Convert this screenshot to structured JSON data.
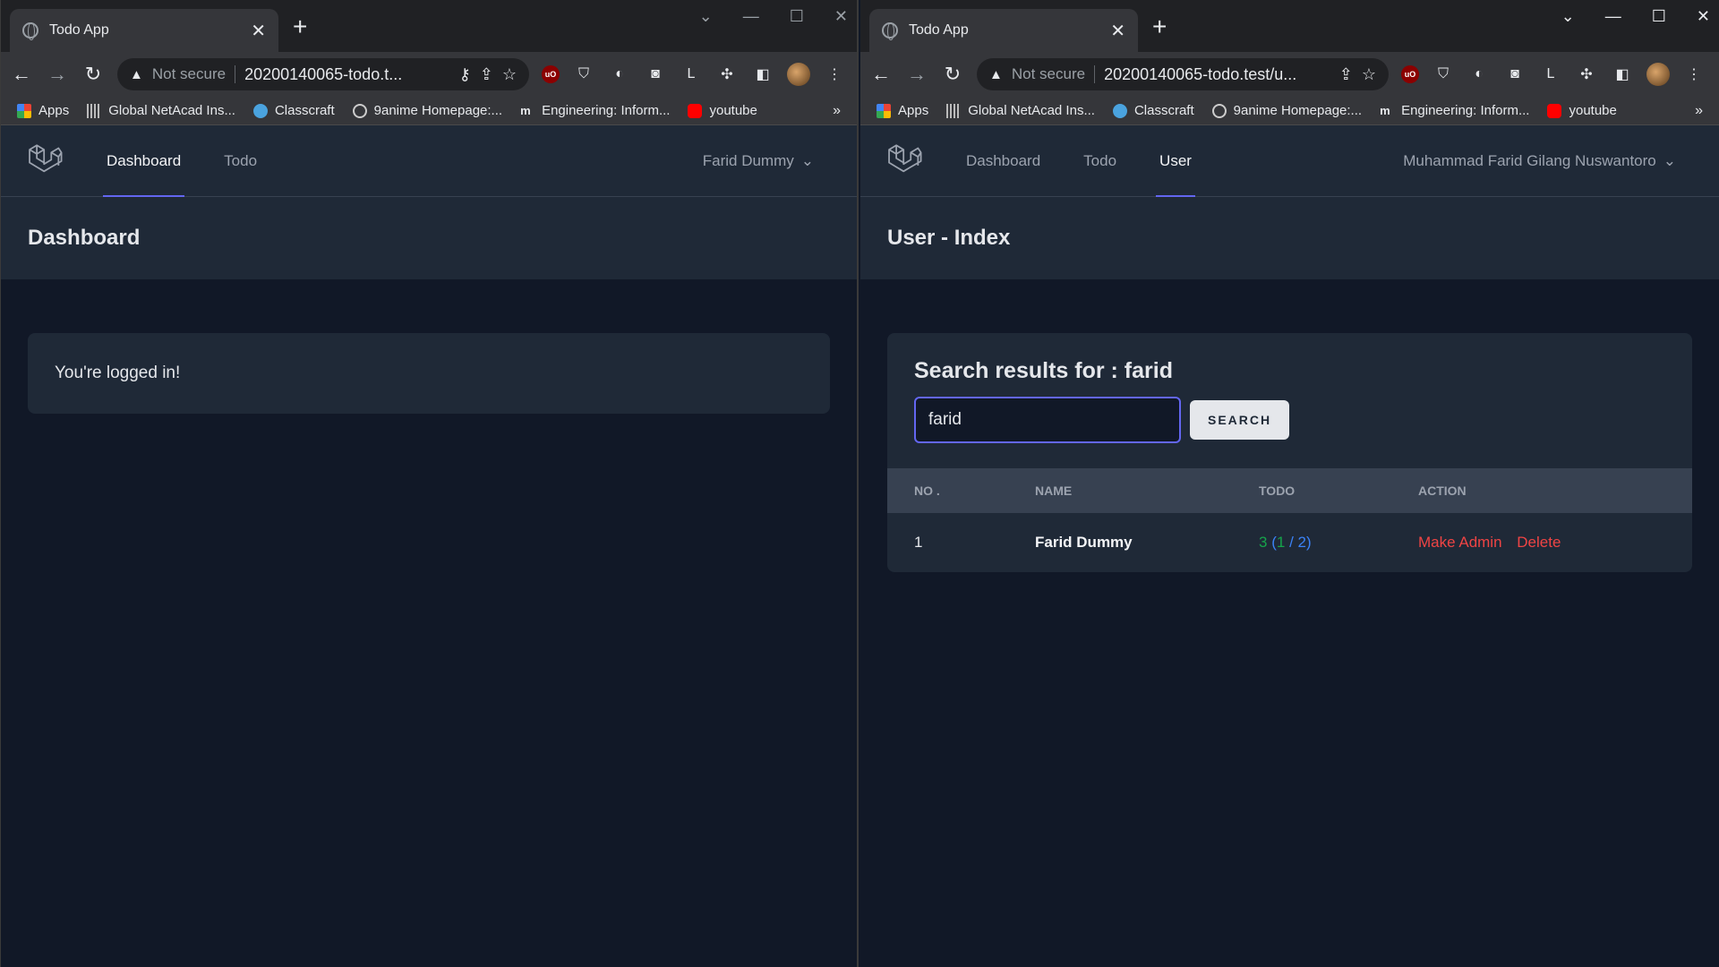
{
  "left": {
    "tab_title": "Todo App",
    "omnibox": {
      "security": "Not secure",
      "url": "20200140065-todo.t..."
    },
    "bookmarks": [
      "Apps",
      "Global NetAcad Ins...",
      "Classcraft",
      "9anime Homepage:...",
      "Engineering: Inform...",
      "youtube"
    ],
    "nav": {
      "links": [
        "Dashboard",
        "Todo"
      ],
      "user": "Farid Dummy"
    },
    "page_title": "Dashboard",
    "message": "You're logged in!"
  },
  "right": {
    "tab_title": "Todo App",
    "omnibox": {
      "security": "Not secure",
      "url": "20200140065-todo.test/u..."
    },
    "bookmarks": [
      "Apps",
      "Global NetAcad Ins...",
      "Classcraft",
      "9anime Homepage:...",
      "Engineering: Inform...",
      "youtube"
    ],
    "nav": {
      "links": [
        "Dashboard",
        "Todo",
        "User"
      ],
      "user": "Muhammad Farid Gilang Nuswantoro"
    },
    "page_title": "User - Index",
    "search": {
      "heading": "Search results for : farid",
      "value": "farid",
      "button": "SEARCH"
    },
    "table": {
      "headers": [
        "NO .",
        "NAME",
        "TODO",
        "ACTION"
      ],
      "rows": [
        {
          "no": "1",
          "name": "Farid Dummy",
          "todo_total": "3",
          "todo_done": "1",
          "todo_pending": "2",
          "action_admin": "Make Admin",
          "action_delete": "Delete"
        }
      ]
    }
  },
  "colors": {
    "accent": "#6366f1",
    "done": "#16a34a",
    "pending": "#3b82f6",
    "danger": "#ef4444"
  },
  "icons": [
    "globe-icon",
    "close-icon",
    "plus-icon",
    "back-icon",
    "forward-icon",
    "reload-icon",
    "warning-icon",
    "key-icon",
    "share-icon",
    "star-icon",
    "puzzle-icon",
    "sidepanel-icon",
    "menu-icon",
    "laravel-logo-icon",
    "chevron-down-icon"
  ]
}
